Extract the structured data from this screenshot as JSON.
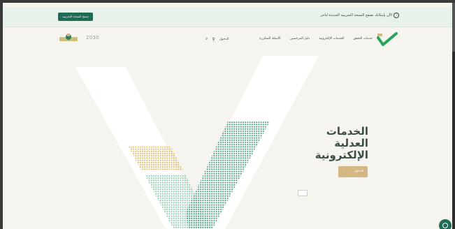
{
  "announcement": {
    "text": "الآن بإمكانك تصفح النسخة التجريبية الجديدة لناجز",
    "button_label": "تصفح النسخة التجريبية",
    "info_icon": "info-icon"
  },
  "header": {
    "nav": [
      "خدمات التحقق",
      "الخدمات الإلكترونية",
      "دليل المرخصين",
      "الأسئلة المتكررة"
    ],
    "login_label": "الدخول",
    "vision_mark": "2030",
    "icons": [
      "user-icon",
      "search-icon",
      "logo-mark",
      "ministry-emblem"
    ]
  },
  "hero": {
    "title_lines": [
      "الخدمات",
      "العدلية",
      "الإلكترونية"
    ],
    "cta_label": "الدخول",
    "cta_icon": "chevron-left-icon"
  },
  "colors": {
    "page_bg": "#f5f4ef",
    "brand_green": "#1f6b55",
    "accent_gold": "#d3b884",
    "announcement_bg": "#e8f1ea",
    "dot_green": "#4a9a7c",
    "dot_gold": "#d9b765"
  }
}
